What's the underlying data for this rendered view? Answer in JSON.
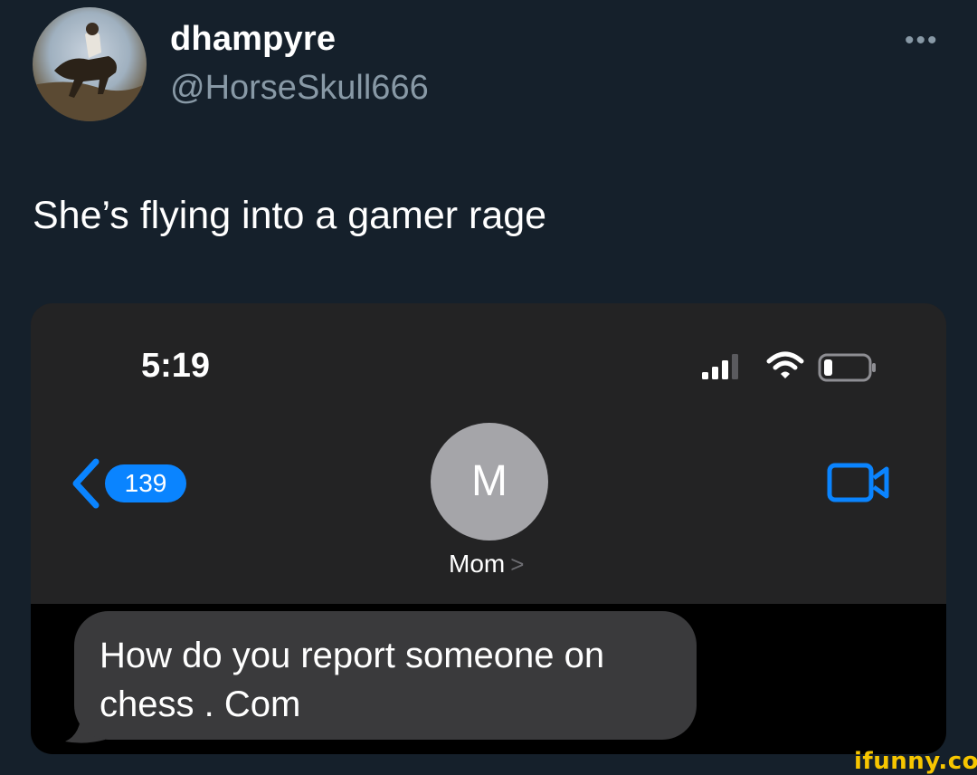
{
  "tweet": {
    "display_name": "dhampyre",
    "handle": "@HorseSkull666",
    "text": "She’s flying into a gamer rage",
    "more_icon": "more-options-icon"
  },
  "phone_screenshot": {
    "status_bar": {
      "time": "5:19",
      "icons": [
        "signal-icon",
        "wifi-icon",
        "battery-icon"
      ]
    },
    "nav": {
      "back_count": "139",
      "contact_initial": "M",
      "contact_name": "Mom",
      "contact_chevron": ">",
      "video_icon": "video-camera-icon"
    },
    "messages": [
      {
        "text": "How do you report someone on\nchess . Com",
        "direction": "incoming"
      }
    ],
    "colors": {
      "accent": "#0a84ff",
      "bubble": "#3a3a3c",
      "contact_avatar": "#a5a5a9"
    }
  },
  "watermark": "ifunny.co",
  "colors": {
    "background": "#15202b",
    "secondary_text": "#8899a6"
  }
}
